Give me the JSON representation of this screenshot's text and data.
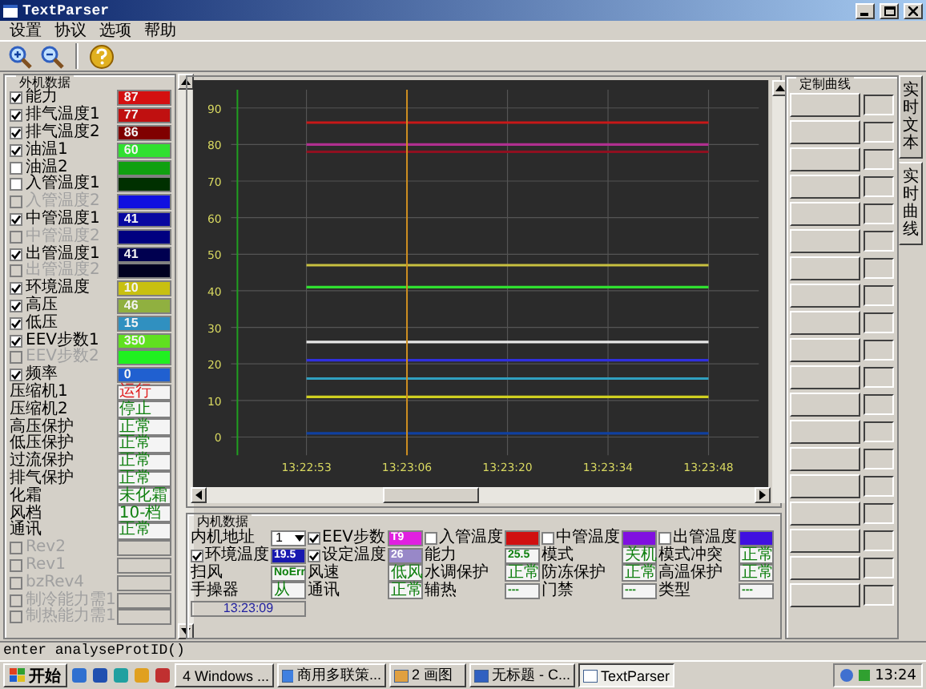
{
  "window": {
    "title": "TextParser"
  },
  "menu": [
    {
      "label": "设置"
    },
    {
      "label": "协议"
    },
    {
      "label": "选项"
    },
    {
      "label": "帮助"
    }
  ],
  "outdoor": {
    "title": "外机数据",
    "items": [
      {
        "kind": "check",
        "label": "能力",
        "checked": true,
        "disabled": false,
        "value": "87",
        "color": "#d41010"
      },
      {
        "kind": "check",
        "label": "排气温度1",
        "checked": true,
        "disabled": false,
        "value": "77",
        "color": "#c01010"
      },
      {
        "kind": "check",
        "label": "排气温度2",
        "checked": true,
        "disabled": false,
        "value": "86",
        "color": "#800000"
      },
      {
        "kind": "check",
        "label": "油温1",
        "checked": true,
        "disabled": false,
        "value": "60",
        "color": "#30e030"
      },
      {
        "kind": "check",
        "label": "油温2",
        "checked": false,
        "disabled": false,
        "color": "#10a010"
      },
      {
        "kind": "check",
        "label": "入管温度1",
        "checked": false,
        "disabled": false,
        "color": "#003000"
      },
      {
        "kind": "check",
        "label": "入管温度2",
        "checked": false,
        "disabled": true,
        "color": "#1010e0"
      },
      {
        "kind": "check",
        "label": "中管温度1",
        "checked": true,
        "disabled": false,
        "value": "41",
        "color": "#0808a0"
      },
      {
        "kind": "check",
        "label": "中管温度2",
        "checked": false,
        "disabled": true,
        "color": "#000080"
      },
      {
        "kind": "check",
        "label": "出管温度1",
        "checked": true,
        "disabled": false,
        "value": "41",
        "color": "#000050"
      },
      {
        "kind": "check",
        "label": "出管温度2",
        "checked": false,
        "disabled": true,
        "color": "#000020"
      },
      {
        "kind": "check",
        "label": "环境温度",
        "checked": true,
        "disabled": false,
        "value": "10",
        "color": "#c8c010"
      },
      {
        "kind": "check",
        "label": "高压",
        "checked": true,
        "disabled": false,
        "value": "46",
        "color": "#90b040"
      },
      {
        "kind": "check",
        "label": "低压",
        "checked": true,
        "disabled": false,
        "value": "15",
        "color": "#3090c0"
      },
      {
        "kind": "check",
        "label": "EEV步数1",
        "checked": true,
        "disabled": false,
        "value": "350",
        "color": "#60e020"
      },
      {
        "kind": "check",
        "label": "EEV步数2",
        "checked": false,
        "disabled": true,
        "color": "#20f020"
      },
      {
        "kind": "check",
        "label": "频率",
        "checked": true,
        "disabled": false,
        "value": "0",
        "color": "#2060d0"
      },
      {
        "kind": "status",
        "label": "压缩机1",
        "disabled": false,
        "value": "运行",
        "color": "#e02020"
      },
      {
        "kind": "status",
        "label": "压缩机2",
        "disabled": false,
        "value": "停止",
        "color": "#108010"
      },
      {
        "kind": "status",
        "label": "高压保护",
        "disabled": false,
        "value": "正常",
        "color": "#108010"
      },
      {
        "kind": "status",
        "label": "低压保护",
        "disabled": false,
        "value": "正常",
        "color": "#108010"
      },
      {
        "kind": "status",
        "label": "过流保护",
        "disabled": false,
        "value": "正常",
        "color": "#108010"
      },
      {
        "kind": "status",
        "label": "排气保护",
        "disabled": false,
        "value": "正常",
        "color": "#108010"
      },
      {
        "kind": "status",
        "label": "化霜",
        "disabled": false,
        "value": "未化霜",
        "color": "#108010"
      },
      {
        "kind": "status",
        "label": "风档",
        "disabled": false,
        "value": "10-档",
        "color": "#108010"
      },
      {
        "kind": "status",
        "label": "通讯",
        "disabled": false,
        "value": "正常",
        "color": "#108010"
      },
      {
        "kind": "check",
        "label": "Rev2",
        "checked": false,
        "disabled": true
      },
      {
        "kind": "check",
        "label": "Rev1",
        "checked": false,
        "disabled": true
      },
      {
        "kind": "check",
        "label": "bzRev4",
        "checked": false,
        "disabled": true
      },
      {
        "kind": "check",
        "label": "制冷能力需1",
        "checked": false,
        "disabled": true
      },
      {
        "kind": "check",
        "label": "制热能力需1",
        "checked": false,
        "disabled": true
      }
    ]
  },
  "chart": {
    "chart_data": {
      "type": "line",
      "grid": true,
      "ref_lines": [
        {
          "axis": "x",
          "value": "13:23:06",
          "color": "#d09020"
        }
      ],
      "categories": [
        "13:22:53",
        "13:23:06",
        "13:23:20",
        "13:23:34",
        "13:23:48"
      ],
      "ylim": [
        -5,
        95
      ],
      "yticks": [
        0,
        10,
        20,
        30,
        40,
        50,
        60,
        70,
        80,
        90
      ],
      "series": [
        {
          "color": "#c81818",
          "values": [
            86,
            86,
            86,
            86,
            86
          ]
        },
        {
          "color": "#b03090",
          "values": [
            80,
            80,
            80,
            80,
            80
          ]
        },
        {
          "color": "#901020",
          "values": [
            78,
            78,
            78,
            78,
            78
          ]
        },
        {
          "color": "#c8c040",
          "values": [
            47,
            47,
            47,
            47,
            47
          ]
        },
        {
          "color": "#30e030",
          "values": [
            41,
            41,
            41,
            41,
            41
          ]
        },
        {
          "color": "#e8e8e8",
          "values": [
            26,
            26,
            26,
            26,
            26
          ]
        },
        {
          "color": "#3030e0",
          "values": [
            21,
            21,
            21,
            21,
            21
          ]
        },
        {
          "color": "#30a0c0",
          "values": [
            16,
            16,
            16,
            16,
            16
          ]
        },
        {
          "color": "#d0d020",
          "values": [
            11,
            11,
            11,
            11,
            11
          ]
        },
        {
          "color": "#1040a0",
          "values": [
            1,
            1,
            1,
            1,
            1
          ]
        }
      ]
    }
  },
  "indoor": {
    "title": "内机数据",
    "groups": [
      {
        "rows": [
          {
            "kind": "select",
            "label": "内机地址",
            "value": "1"
          },
          {
            "kind": "check",
            "label": "环境温度",
            "checked": true,
            "value": "19.5",
            "color": "#1818b0"
          },
          {
            "kind": "text",
            "label": "扫风",
            "value": "NoErr"
          },
          {
            "kind": "text",
            "label": "手操器",
            "value": "从"
          }
        ]
      },
      {
        "rows": [
          {
            "kind": "check",
            "label": "EEV步数",
            "checked": true,
            "value": "T9",
            "color": "#e020e0"
          },
          {
            "kind": "check",
            "label": "设定温度",
            "checked": true,
            "value": "26",
            "color": "#9888c8"
          },
          {
            "kind": "text",
            "label": "风速",
            "value": "低风"
          },
          {
            "kind": "text",
            "label": "通讯",
            "value": "正常"
          }
        ]
      },
      {
        "rows": [
          {
            "kind": "check",
            "label": "入管温度",
            "checked": false,
            "color": "#d01010"
          },
          {
            "kind": "text",
            "label": "能力",
            "value": "25.5"
          },
          {
            "kind": "text",
            "label": "水调保护",
            "value": "正常"
          },
          {
            "kind": "text",
            "label": "辅热",
            "value": "---"
          }
        ]
      },
      {
        "rows": [
          {
            "kind": "check",
            "label": "中管温度",
            "checked": false,
            "color": "#8010e0"
          },
          {
            "kind": "text",
            "label": "模式",
            "value": "关机"
          },
          {
            "kind": "text",
            "label": "防冻保护",
            "value": "正常"
          },
          {
            "kind": "text",
            "label": "门禁",
            "value": "---"
          }
        ]
      },
      {
        "rows": [
          {
            "kind": "check",
            "label": "出管温度",
            "checked": false,
            "color": "#4010e0"
          },
          {
            "kind": "text",
            "label": "模式冲突",
            "value": "正常"
          },
          {
            "kind": "text",
            "label": "高温保护",
            "value": "正常"
          },
          {
            "kind": "text",
            "label": "类型",
            "value": "---"
          }
        ]
      }
    ],
    "time": "13:23:09"
  },
  "custom": {
    "title": "定制曲线"
  },
  "side_tabs": [
    {
      "label": "实时文本",
      "selected": false
    },
    {
      "label": "实时曲线",
      "selected": true
    }
  ],
  "status_bar": "enter analyseProtID()",
  "taskbar": {
    "start": "开始",
    "tasks": [
      {
        "label": "4 Windows ...",
        "selected": false
      },
      {
        "label": "商用多联策...",
        "selected": false
      },
      {
        "label": "2 画图",
        "selected": false
      },
      {
        "label": "无标题 - C...",
        "selected": false
      },
      {
        "label": "TextParser",
        "selected": true
      }
    ],
    "clock": "13:24"
  }
}
